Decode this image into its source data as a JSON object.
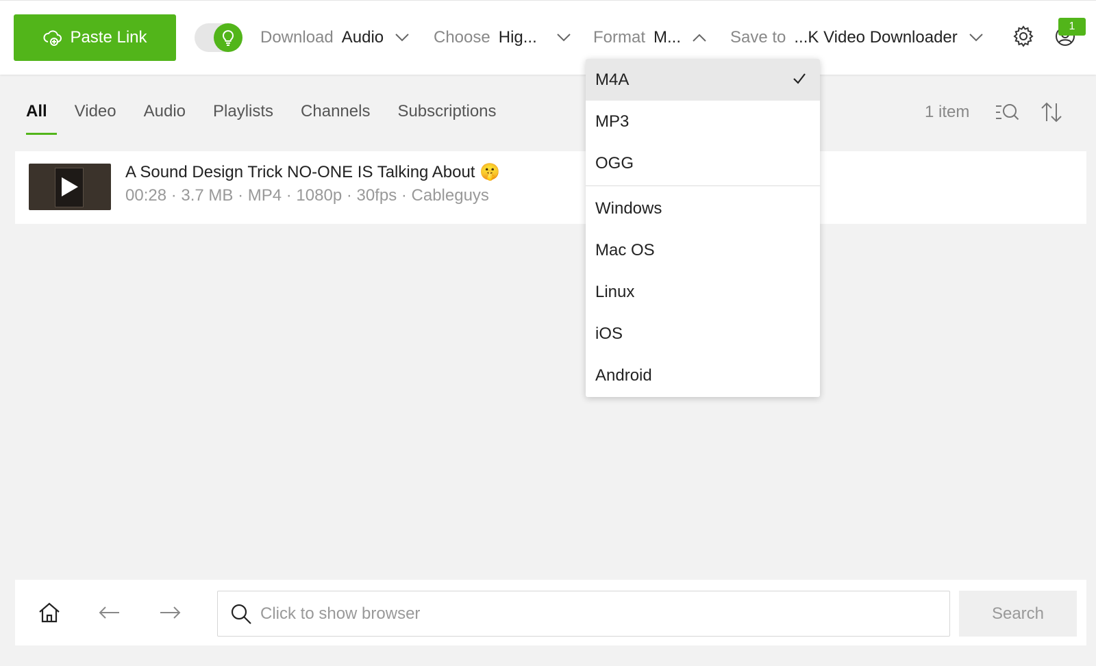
{
  "toolbar": {
    "paste_link_label": "Paste Link",
    "download": {
      "label": "Download",
      "value": "Audio"
    },
    "choose": {
      "label": "Choose",
      "value": "Hig..."
    },
    "format": {
      "label": "Format",
      "value": "M..."
    },
    "save_to": {
      "label": "Save to",
      "value": "...K Video Downloader"
    },
    "notification_count": "1"
  },
  "tabs": [
    "All",
    "Video",
    "Audio",
    "Playlists",
    "Channels",
    "Subscriptions"
  ],
  "active_tab": "All",
  "item_count": "1 item",
  "items": [
    {
      "title": "A Sound Design Trick NO-ONE IS Talking About 🤫",
      "meta": "00:28 · 3.7 MB · MP4 · 1080p · 30fps · Cableguys"
    }
  ],
  "format_dropdown": {
    "selected": "M4A",
    "groups": [
      [
        "M4A",
        "MP3",
        "OGG"
      ],
      [
        "Windows",
        "Mac OS",
        "Linux",
        "iOS",
        "Android"
      ]
    ]
  },
  "bottom": {
    "search_placeholder": "Click to show browser",
    "search_button": "Search"
  },
  "colors": {
    "accent": "#52b51a",
    "muted_text": "#999999",
    "background": "#f2f2f2"
  },
  "icons": [
    "cloud-plus-icon",
    "lightbulb-icon",
    "chevron-down-icon",
    "chevron-up-icon",
    "gear-icon",
    "user-icon",
    "search-list-icon",
    "sort-icon",
    "checkmark-icon",
    "home-icon",
    "arrow-left-icon",
    "arrow-right-icon",
    "search-icon",
    "play-icon"
  ]
}
